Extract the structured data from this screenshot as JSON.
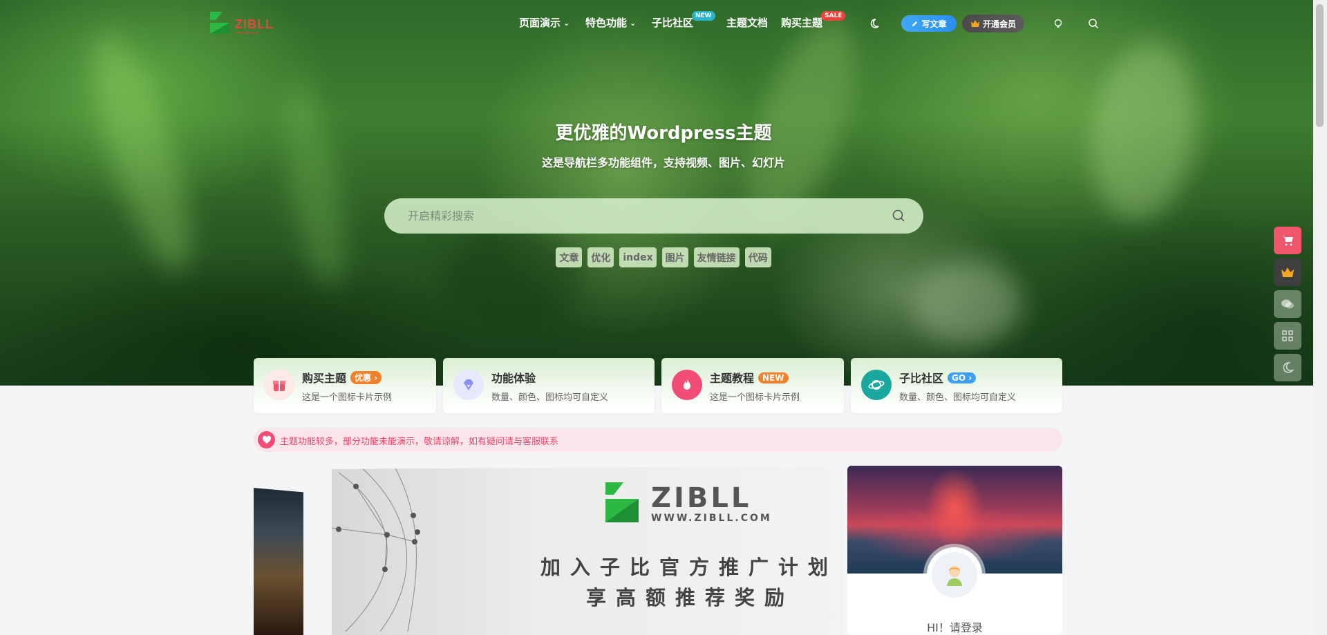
{
  "header": {
    "logo_text": "ZIBLL",
    "nav": [
      {
        "label": "页面演示",
        "has_dropdown": true
      },
      {
        "label": "特色功能",
        "has_dropdown": true
      },
      {
        "label": "子比社区",
        "badge": "NEW"
      },
      {
        "label": "主题文档"
      },
      {
        "label": "购买主题",
        "badge": "SALE"
      }
    ],
    "write_label": "写文章",
    "vip_label": "开通会员",
    "icons": [
      "moon-icon",
      "pencil-icon",
      "crown-icon",
      "bulb-icon",
      "search-icon"
    ]
  },
  "hero": {
    "title": "更优雅的Wordpress主题",
    "subtitle": "这是导航栏多功能组件，支持视频、图片、幻灯片",
    "search_placeholder": "开启精彩搜索",
    "tags": [
      "文章",
      "优化",
      "index",
      "图片",
      "友情链接",
      "代码"
    ]
  },
  "cards": [
    {
      "title": "购买主题",
      "badge": "优惠",
      "badge_color": "#f2812b",
      "desc": "这是一个图标卡片示例",
      "icon": "gift-icon",
      "icon_bg": "#fde9e6",
      "icon_color": "#f0566b"
    },
    {
      "title": "功能体验",
      "desc": "数量、颜色、图标均可自定义",
      "icon": "diamond-icon",
      "icon_bg": "#e6e8fb",
      "icon_color": "#7b7ff0"
    },
    {
      "title": "主题教程",
      "badge": "NEW",
      "badge_color": "#f2812b",
      "desc": "这是一个图标卡片示例",
      "icon": "fire-icon",
      "icon_bg": "#f24d76",
      "icon_color": "#ffffff"
    },
    {
      "title": "子比社区",
      "badge": "GO",
      "badge_color": "#3fa0f0",
      "desc": "数量、颜色、图标均可自定义",
      "icon": "planet-icon",
      "icon_bg": "#1aa89e",
      "icon_color": "#ffffff"
    }
  ],
  "notice": {
    "text": "主题功能较多，部分功能未能演示，敬请谅解，如有疑问请与客服联系"
  },
  "slider": {
    "logo_text": "ZIBLL",
    "site": "WWW.ZIBLL.COM",
    "line1": "加入子比官方推广计划",
    "line2": "享高额推荐奖励"
  },
  "user_panel": {
    "greeting": "HI！请登录"
  },
  "float_bar": [
    {
      "icon": "cart-icon",
      "color": "#f0566b"
    },
    {
      "icon": "crown-icon",
      "color": "#3f3f3f"
    },
    {
      "icon": "wechat-icon",
      "color": "#a7b7a0"
    },
    {
      "icon": "qrcode-icon",
      "color": "#a7b7a0"
    },
    {
      "icon": "moon-icon",
      "color": "#a7b7a0"
    }
  ],
  "colors": {
    "accent_blue": "#2b8df0",
    "brand_green": "#2db843",
    "brand_red": "#e8463a",
    "notice_pink": "#f0436a"
  }
}
